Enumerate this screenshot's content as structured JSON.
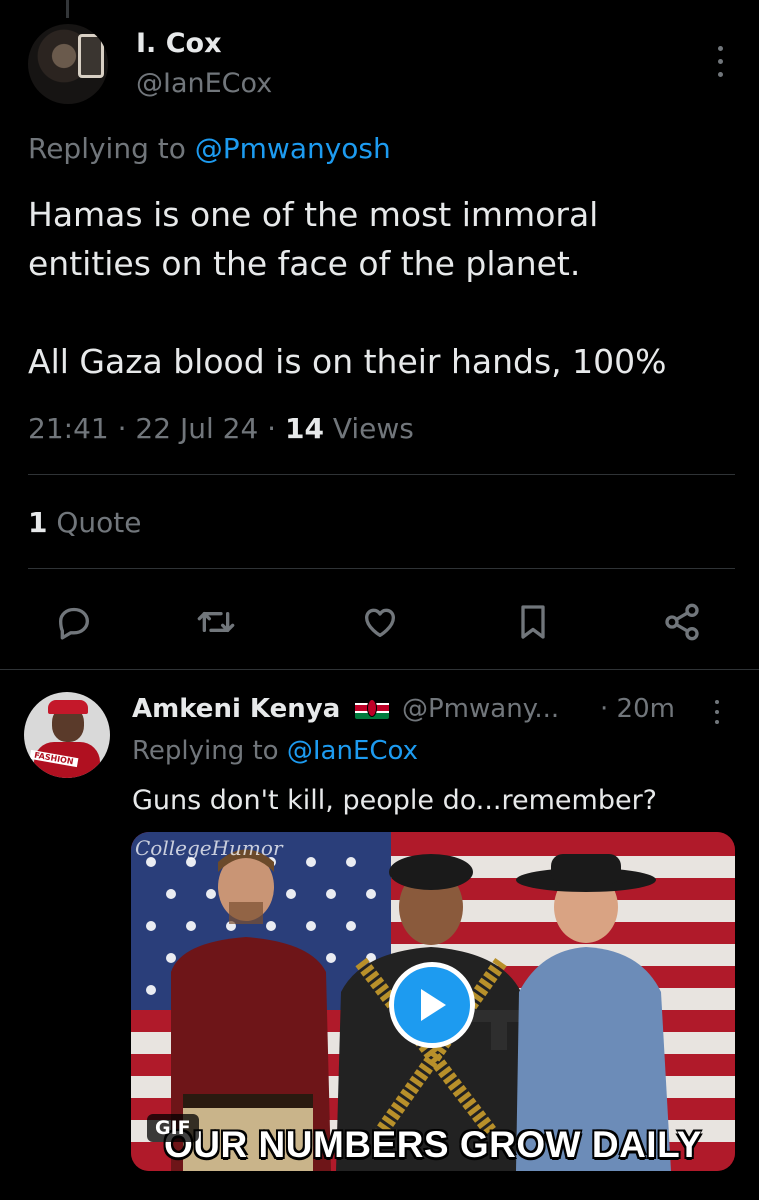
{
  "tweet": {
    "author": {
      "name": "I. Cox",
      "handle": "@IanECox"
    },
    "replying_prefix": "Replying to",
    "replying_to": "@Pmwanyosh",
    "text_lines": [
      "Hamas is one of the most immoral entities on the face of the planet.",
      "All Gaza blood is on their hands, 100%"
    ],
    "time": "21:41",
    "date": "22 Jul 24",
    "separator": "·",
    "views_count": "14",
    "views_label": "Views",
    "quote_count": "1",
    "quote_label": "Quote",
    "actions": [
      "reply-icon",
      "retweet-icon",
      "like-icon",
      "bookmark-icon",
      "share-icon"
    ]
  },
  "reply": {
    "author": {
      "name": "Amkeni Kenya",
      "flag": "kenya-flag-icon",
      "handle": "@Pmwany...",
      "time": "· 20m"
    },
    "replying_prefix": "Replying to",
    "replying_to": "@IanECox",
    "text": "Guns don't kill, people do...remember?",
    "media": {
      "type": "GIF",
      "badge": "GIF",
      "watermark": "CollegeHumor",
      "caption": "OUR NUMBERS GROW DAILY"
    }
  },
  "colors": {
    "background": "#000000",
    "text": "#e7e9ea",
    "secondary": "#71767b",
    "accent": "#1d9bf0",
    "divider": "#2f3336"
  }
}
